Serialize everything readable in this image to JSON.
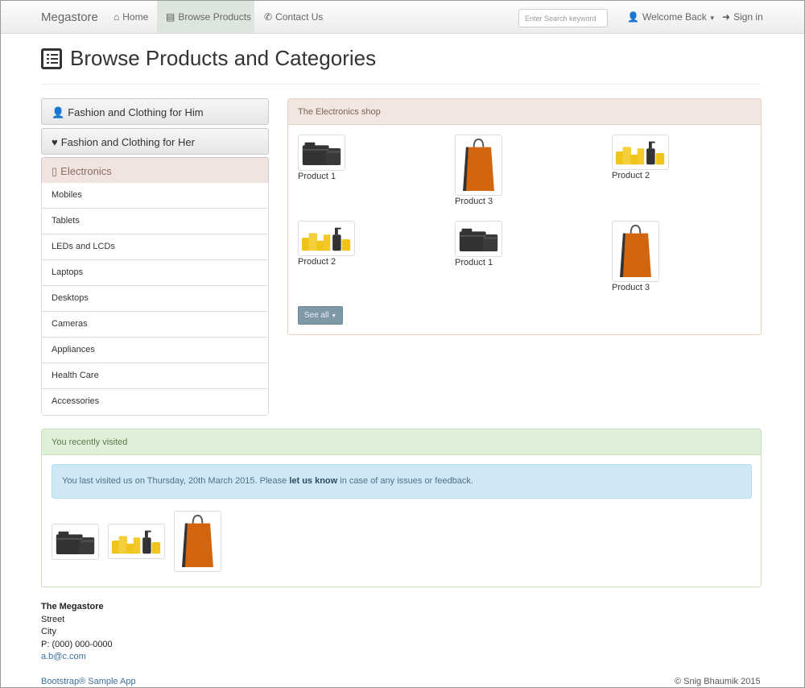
{
  "navbar": {
    "brand": "Megastore",
    "home_label": "Home",
    "browse_label": "Browse Products",
    "contact_label": "Contact Us",
    "search_placeholder": "Enter Search keyword",
    "welcome_label": "Welcome Back",
    "signin_label": "Sign in"
  },
  "page": {
    "title": "Browse Products and Categories"
  },
  "categories": {
    "him": "Fashion and Clothing for Him",
    "her": "Fashion and Clothing for Her",
    "electronics": "Electronics",
    "items": [
      "Mobiles",
      "Tablets",
      "LEDs and LCDs",
      "Laptops",
      "Desktops",
      "Cameras",
      "Appliances",
      "Health Care",
      "Accessories"
    ]
  },
  "shop": {
    "heading": "The Electronics shop",
    "products": [
      "Product 1",
      "Product 3",
      "Product 2",
      "Product 2",
      "Product 1",
      "Product 3"
    ],
    "see_all": "See all"
  },
  "recent": {
    "heading": "You recently visited",
    "alert_before": "You last visited us on Thursday, 20th March 2015. Please ",
    "alert_link": "let us know",
    "alert_after": " in case of any issues or feedback."
  },
  "footer": {
    "company": "The Megastore",
    "street": "Street",
    "city": "City",
    "phone": "P: (000) 000-0000",
    "email": "a.b@c.com",
    "app": "Bootstrap® Sample App",
    "copyright": "© Snig Bhaumik 2015"
  },
  "colors": {
    "camera": "#333333",
    "bag": "#d4650f",
    "bottles": "#f0c419",
    "nav_active": "#dde6de",
    "shop_head": "#f2e6e0",
    "recent_head": "#dff0d8",
    "alert_bg": "#d0e8f5"
  }
}
